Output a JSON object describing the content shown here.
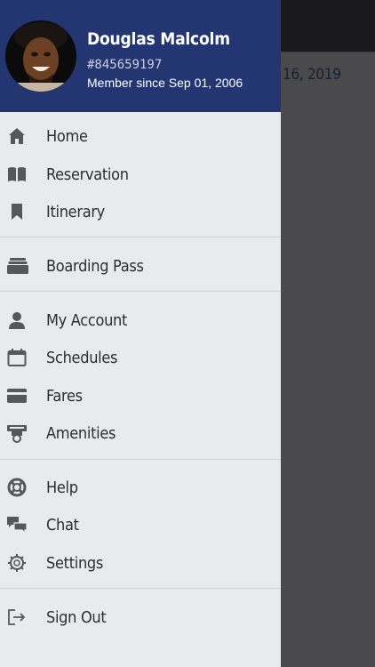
{
  "profile": {
    "name": "Douglas Malcolm",
    "member_id": "#845659197",
    "member_since": "Member since Sep 01, 2006",
    "header_color": "#233672"
  },
  "menu": {
    "groups": [
      {
        "items": [
          {
            "label": "Home",
            "icon": "home-icon"
          },
          {
            "label": "Reservation",
            "icon": "book-icon"
          },
          {
            "label": "Itinerary",
            "icon": "bookmark-icon"
          }
        ]
      },
      {
        "items": [
          {
            "label": "Boarding Pass",
            "icon": "ticket-stack-icon"
          }
        ]
      },
      {
        "items": [
          {
            "label": "My Account",
            "icon": "user-icon"
          },
          {
            "label": "Schedules",
            "icon": "calendar-icon"
          },
          {
            "label": "Fares",
            "icon": "credit-card-icon"
          },
          {
            "label": "Amenities",
            "icon": "amenities-icon"
          }
        ]
      },
      {
        "items": [
          {
            "label": "Help",
            "icon": "lifebuoy-icon"
          },
          {
            "label": "Chat",
            "icon": "chat-bubbles-icon"
          },
          {
            "label": "Settings",
            "icon": "gear-icon"
          }
        ]
      },
      {
        "items": [
          {
            "label": "Sign Out",
            "icon": "sign-out-icon"
          }
        ]
      }
    ]
  },
  "background": {
    "date_fragment": "16, 2019"
  }
}
